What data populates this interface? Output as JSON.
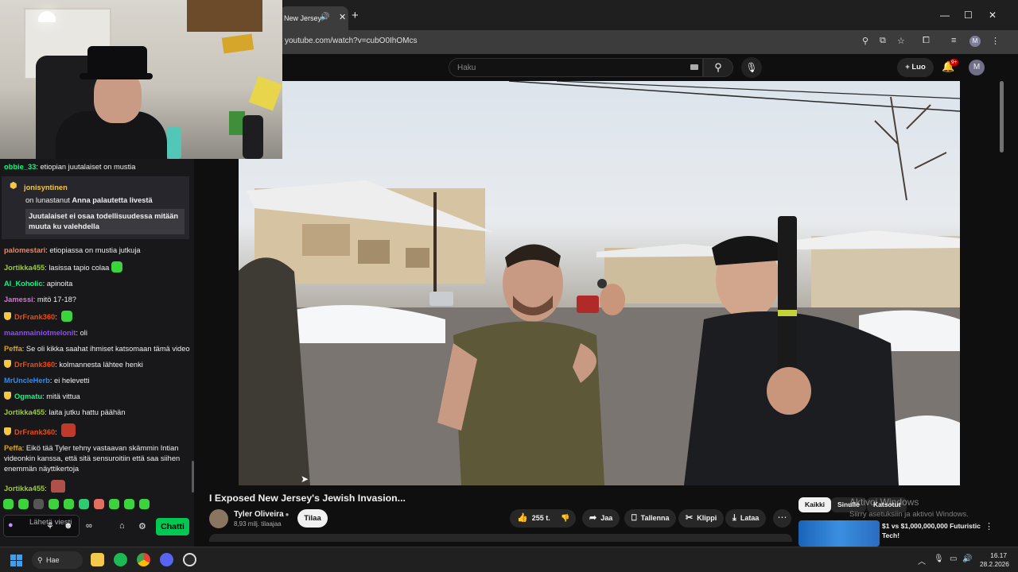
{
  "chat": {
    "messages": [
      {
        "user": "obbie_33",
        "color": "#00ff7f",
        "text": "etiopian juutalaiset on mustia",
        "badge": false,
        "emote": null
      },
      {
        "user": "palomestari",
        "color": "#ff7f50",
        "text": "etiopiassa on mustia jutkuja",
        "badge": false,
        "emote": null
      },
      {
        "user": "Jortikka455",
        "color": "#9acd32",
        "text": "lasissa tapio colaa",
        "badge": false,
        "emote": "#3cd43c"
      },
      {
        "user": "Al_Koholic",
        "color": "#00ff7f",
        "text": "apinoita",
        "badge": false,
        "emote": null
      },
      {
        "user": "Jamessi",
        "color": "#da70d6",
        "text": "mitö 17-18?",
        "badge": false,
        "emote": null
      },
      {
        "user": "DrFrank360",
        "color": "#ff4500",
        "text": "",
        "badge": true,
        "emote": "#3cd43c"
      },
      {
        "user": "maanmainiotmelonit",
        "color": "#9146ff",
        "text": "oli",
        "badge": false,
        "emote": null
      },
      {
        "user": "Peffa",
        "color": "#daa520",
        "text": "Se oli kikka saahat ihmiset katsomaan tämä video",
        "badge": false,
        "emote": null
      },
      {
        "user": "DrFrank360",
        "color": "#ff4500",
        "text": "kolmannesta lähtee henki",
        "badge": true,
        "emote": null
      },
      {
        "user": "MrUncleHerb",
        "color": "#1e90ff",
        "text": "ei helevetti",
        "badge": false,
        "emote": null
      },
      {
        "user": "Ogmatu",
        "color": "#00ff7f",
        "text": "mitä vittua",
        "badge": true,
        "emote": null
      },
      {
        "user": "Jortikka455",
        "color": "#9acd32",
        "text": "laita jutku hattu päähän",
        "badge": false,
        "emote": null
      },
      {
        "user": "DrFrank360",
        "color": "#ff4500",
        "text": "",
        "badge": true,
        "emote": "#c0392b"
      },
      {
        "user": "Peffa",
        "color": "#daa520",
        "text": "Eikö tää Tyler tehny vastaavan skämmin Intian videonkin kanssa, että sitä sensuroitiin että saa siihen enemmän näyttikertoja",
        "badge": false,
        "emote": null
      },
      {
        "user": "Jortikka455",
        "color": "#9acd32",
        "text": "",
        "badge": false,
        "emote": "#b0504a"
      }
    ],
    "redemption": {
      "user": "jonisyntinen",
      "text_prefix": "on lunastanut",
      "reward": "Anna palautetta livestä",
      "message": "Juutalaiset ei osaa todellisuudessa mitään muuta ku valehdella"
    },
    "input_placeholder": "Lähetä viesti",
    "send_button": "Chatti"
  },
  "browser": {
    "tab_title": "New Jersey",
    "url": "youtube.com/watch?v=cubO0IhOMcs",
    "profile_initial": "M"
  },
  "youtube": {
    "search_placeholder": "Haku",
    "create_label": "Luo",
    "notif_count": "9+",
    "avatar_initial": "M",
    "video_title": "I Exposed New Jersey's Jewish Invasion...",
    "channel_name": "Tyler Oliveira",
    "subscribers": "8,93 milj. tilaajaa",
    "subscribe_label": "Tilaa",
    "likes": "255 t.",
    "share_label": "Jaa",
    "save_label": "Tallenna",
    "clip_label": "Klippi",
    "download_label": "Lataa",
    "chips": [
      "Kaikki",
      "Sinulle",
      "Katsotut"
    ],
    "rec_title": "$1 vs $1,000,000,000 Futuristic Tech!",
    "activate_title": "Aktivoi Windows",
    "activate_sub": "Siirry asetuksiin ja aktivoi Windows."
  },
  "taskbar": {
    "search_label": "Hae",
    "time": "16.17",
    "date": "28.2.2026"
  }
}
